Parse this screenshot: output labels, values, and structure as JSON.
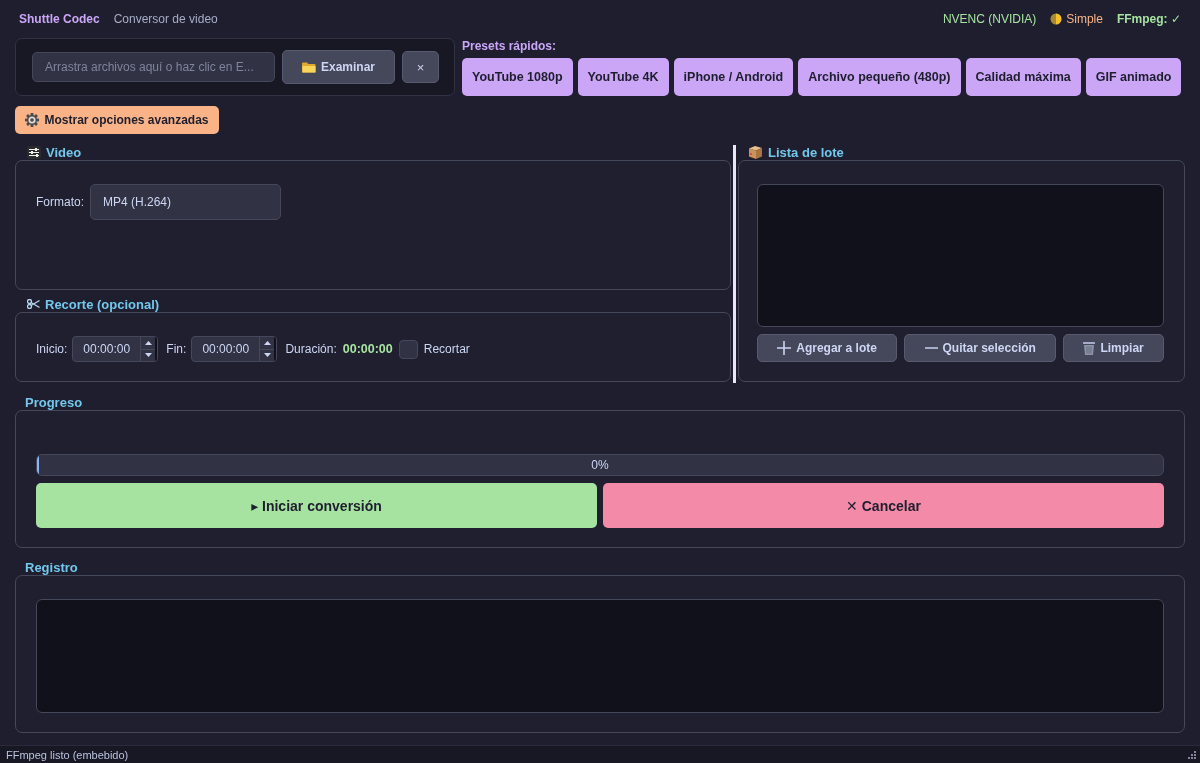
{
  "header": {
    "app_name": "Shuttle Codec",
    "subtitle": "Conversor de video",
    "encoder": "NVENC (NVIDIA)",
    "theme_mode": "Simple",
    "ffmpeg_status": "FFmpeg: ✓"
  },
  "file_input": {
    "placeholder": "Arrastra archivos aquí o haz clic en E...",
    "browse_button": "Examinar",
    "clear_button": "×"
  },
  "presets": {
    "label": "Presets rápidos:",
    "items": [
      "YouTube 1080p",
      "YouTube 4K",
      "iPhone / Android",
      "Archivo pequeño (480p)",
      "Calidad máxima",
      "GIF animado"
    ]
  },
  "advanced_toggle": {
    "label": "Mostrar opciones avanzadas"
  },
  "video_group": {
    "title": "Video",
    "format_label": "Formato:",
    "format_value": "MP4 (H.264)"
  },
  "trim_group": {
    "title": "Recorte (opcional)",
    "start_label": "Inicio:",
    "start_value": "00:00:00",
    "end_label": "Fin:",
    "end_value": "00:00:00",
    "duration_label": "Duración:",
    "duration_value": "00:00:00",
    "trim_checkbox": {
      "label": "Recortar",
      "checked": false
    }
  },
  "batch_group": {
    "title": "Lista de lote",
    "buttons": [
      {
        "kind": "add",
        "label": "Agregar a lote"
      },
      {
        "kind": "remove",
        "label": "Quitar selección"
      },
      {
        "kind": "clear",
        "label": "Limpiar"
      }
    ]
  },
  "progress_group": {
    "title": "Progreso",
    "level": 0,
    "reading": "0%",
    "start_button": "▸ Iniciar conversión",
    "cancel_button": "✕ Cancelar"
  },
  "log_group": {
    "title": "Registro"
  },
  "status_bar": {
    "text": "FFmpeg listo (embebido)"
  }
}
